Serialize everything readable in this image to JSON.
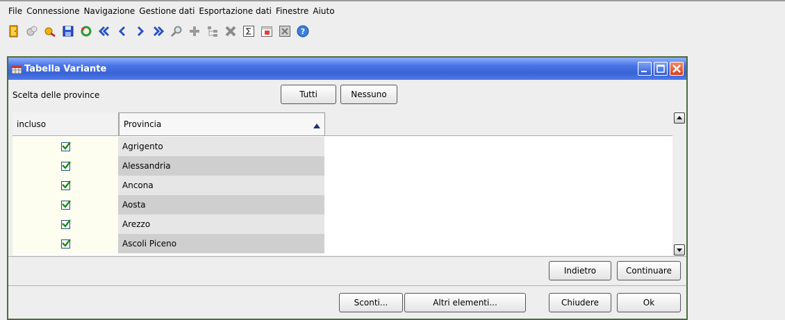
{
  "menu": [
    "File",
    "Connessione",
    "Navigazione",
    "Gestione dati",
    "Esportazione dati",
    "Finestre",
    "Aiuto"
  ],
  "toolbar_icons": [
    "exit-icon",
    "connect-icon",
    "disconnect-icon",
    "save-icon",
    "refresh-icon",
    "first-record-icon",
    "previous-record-icon",
    "next-record-icon",
    "last-record-icon",
    "search-icon",
    "add-icon",
    "tree-icon",
    "delete-icon",
    "sum-icon",
    "calendar-icon",
    "export-icon",
    "help-icon"
  ],
  "frame": {
    "title": "Tabella Variante"
  },
  "selection": {
    "label": "Scelta delle province",
    "all_label": "Tutti",
    "none_label": "Nessuno"
  },
  "table": {
    "columns": [
      "incluso",
      "Provincia"
    ],
    "rows": [
      {
        "included": true,
        "province": "Agrigento"
      },
      {
        "included": true,
        "province": "Alessandria"
      },
      {
        "included": true,
        "province": "Ancona"
      },
      {
        "included": true,
        "province": "Aosta"
      },
      {
        "included": true,
        "province": "Arezzo"
      },
      {
        "included": true,
        "province": "Ascoli Piceno"
      }
    ]
  },
  "nav_buttons": {
    "back_label": "Indietro",
    "continue_label": "Continuare"
  },
  "footer_buttons": {
    "discounts_label": "Sconti...",
    "other_label": "Altri elementi...",
    "close_label": "Chiudere",
    "ok_label": "Ok"
  },
  "colors": {
    "title_bar": "#3a63d6",
    "check": "#1a8a1a",
    "row_even": "#e6e6e6",
    "row_odd": "#cfcfcf",
    "check_col": "#fdfdf0"
  }
}
